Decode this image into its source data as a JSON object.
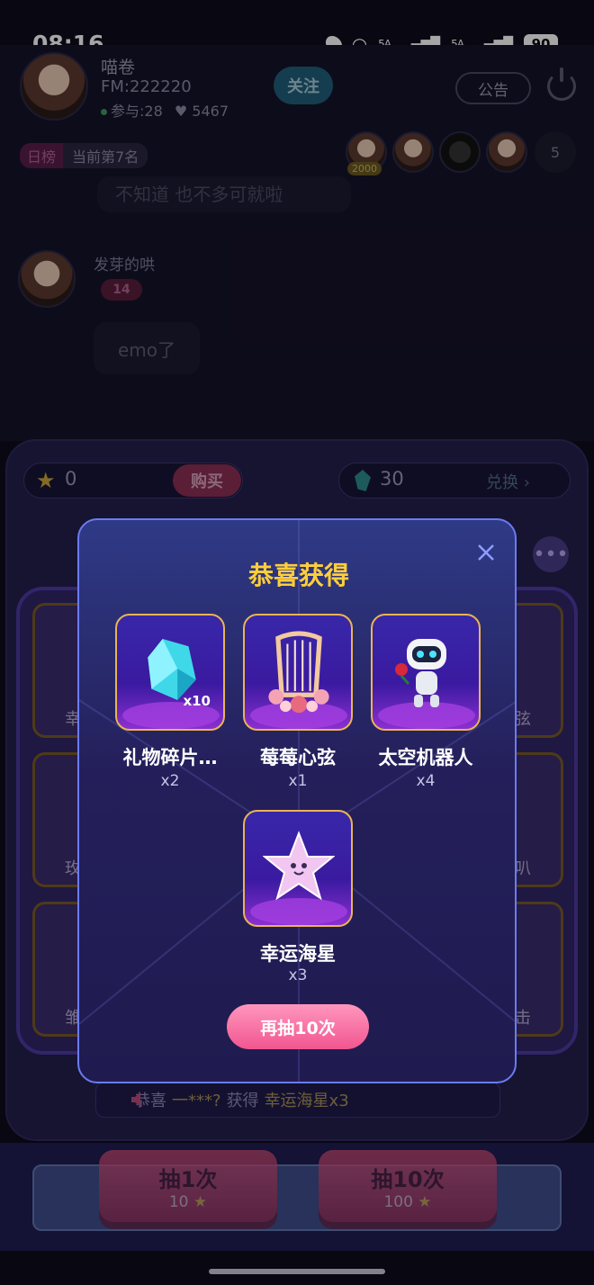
{
  "status_bar": {
    "time": "08:16",
    "net1": "5A",
    "net2": "5A",
    "battery": "90"
  },
  "host": {
    "name": "喵卷",
    "fm": "FM:222220",
    "participants": "参与:28",
    "likes": "5467",
    "follow_label": "关注"
  },
  "header": {
    "notice_label": "公告"
  },
  "rank": {
    "tag": "日榜",
    "value": "当前第7名"
  },
  "viewers": {
    "badge": "2000",
    "count": "5"
  },
  "chat": {
    "partial_msg": "不知道 也不多可就啦",
    "sender": "发芽的哄",
    "level": "14",
    "message": "emo了"
  },
  "wallet": {
    "coins": "0",
    "buy_label": "购买",
    "gems": "30",
    "exchange_label": "兑换"
  },
  "machine_slots": {
    "left": [
      "幸",
      "玫",
      "雏"
    ],
    "right": [
      "弦",
      "叭",
      "击"
    ]
  },
  "marquee": {
    "prefix": "恭喜",
    "user": "一***?",
    "verb": "获得",
    "item": "幸运海星x3"
  },
  "draws": [
    {
      "label": "抽1次",
      "price": "10"
    },
    {
      "label": "抽10次",
      "price": "100"
    }
  ],
  "modal": {
    "title": "恭喜获得",
    "prizes": [
      {
        "name": "礼物碎片…",
        "qty": "x2",
        "tag": "x10",
        "icon": "crystal-shard-icon"
      },
      {
        "name": "莓莓心弦",
        "qty": "x1",
        "icon": "harp-icon"
      },
      {
        "name": "太空机器人",
        "qty": "x4",
        "icon": "robot-icon"
      },
      {
        "name": "幸运海星",
        "qty": "x3",
        "icon": "starfish-icon"
      }
    ],
    "again_label": "再抽10次"
  },
  "colors": {
    "accent_gold": "#ffcf3a",
    "modal_border": "#6b7bf0",
    "again_pink": "#f15690"
  }
}
